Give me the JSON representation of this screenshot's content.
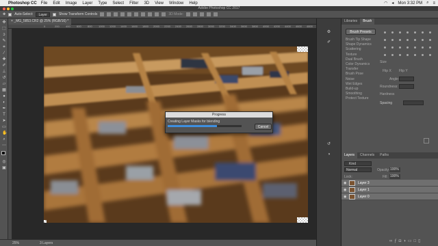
{
  "menubar": {
    "app": "Photoshop CC",
    "items": [
      "File",
      "Edit",
      "Image",
      "Layer",
      "Type",
      "Select",
      "Filter",
      "3D",
      "View",
      "Window",
      "Help"
    ],
    "clock": "Mon 3:32 PM"
  },
  "window": {
    "title": "Adobe Photoshop CC 2017"
  },
  "options": {
    "auto_select_label": "Auto-Select:",
    "auto_select_value": "Layer",
    "transform_label": "Show Transform Controls",
    "mode_label": "3D Mode:"
  },
  "document": {
    "tab_title": "_MG_5853.CR2 @ 25% (RGB/16) *",
    "ruler_ticks": [
      "0",
      "200",
      "400",
      "600",
      "800",
      "1000",
      "1200",
      "1400",
      "1600",
      "1800",
      "2000",
      "2200",
      "2400",
      "2600",
      "2800",
      "3000",
      "3200",
      "3400",
      "3600",
      "3800",
      "4000",
      "4200",
      "4400",
      "4600",
      "4800",
      "5000"
    ]
  },
  "dialog": {
    "title": "Progress",
    "message": "Creating Layer Masks for blending",
    "progress": 0.67,
    "cancel_label": "Cancel"
  },
  "statusbar": {
    "zoom": "25%",
    "layers": "3 Layers"
  },
  "panels": {
    "top_tabs": [
      "Libraries",
      "Brush"
    ],
    "brush_presets_label": "Brush Presets",
    "brush_options": [
      "Brush Tip Shape",
      "Shape Dynamics",
      "Scattering",
      "Texture",
      "Dual Brush",
      "Color Dynamics",
      "Transfer",
      "Brush Pose",
      "Noise",
      "Wet Edges",
      "Build-up",
      "Smoothing",
      "Protect Texture"
    ],
    "size_label": "Size",
    "flip_x": "Flip X",
    "flip_y": "Flip Y",
    "angle_label": "Angle:",
    "roundness_label": "Roundness:",
    "hardness_label": "Hardness",
    "spacing_label": "Spacing",
    "bottom_tabs": [
      "Layers",
      "Channels",
      "Paths"
    ],
    "kind_label": "Kind",
    "blend_mode": "Normal",
    "opacity_label": "Opacity:",
    "opacity_value": "100%",
    "lock_label": "Lock:",
    "fill_label": "Fill:",
    "fill_value": "100%",
    "layers": [
      "Layer 3",
      "Layer 1",
      "Layer 0"
    ]
  },
  "colors": {
    "accent": "#3d8fe0",
    "panel": "#535353",
    "background": "#282828"
  }
}
